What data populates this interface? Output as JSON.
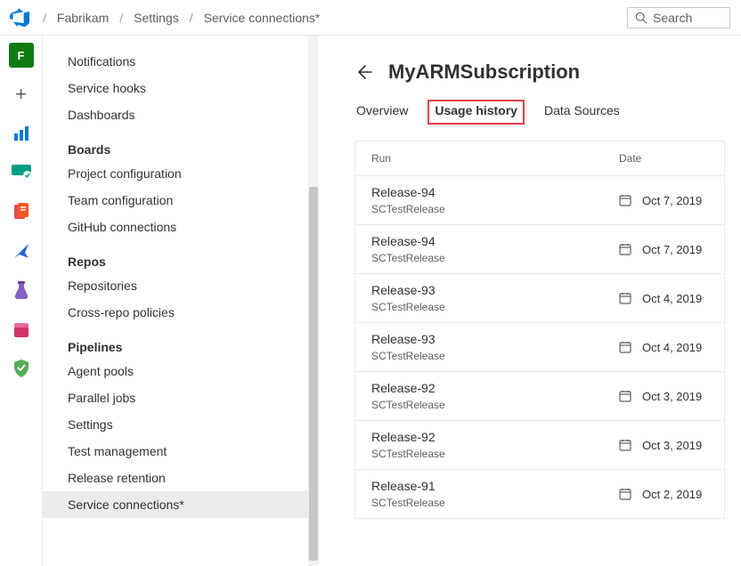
{
  "breadcrumb": [
    "Fabrikam",
    "Settings",
    "Service connections*"
  ],
  "search_placeholder": "Search",
  "iconrail_letter": "F",
  "settings_menu": [
    {
      "label": "Notifications",
      "type": "item"
    },
    {
      "label": "Service hooks",
      "type": "item"
    },
    {
      "label": "Dashboards",
      "type": "item"
    },
    {
      "label": "Boards",
      "type": "hdr"
    },
    {
      "label": "Project configuration",
      "type": "item"
    },
    {
      "label": "Team configuration",
      "type": "item"
    },
    {
      "label": "GitHub connections",
      "type": "item"
    },
    {
      "label": "Repos",
      "type": "hdr"
    },
    {
      "label": "Repositories",
      "type": "item"
    },
    {
      "label": "Cross-repo policies",
      "type": "item"
    },
    {
      "label": "Pipelines",
      "type": "hdr"
    },
    {
      "label": "Agent pools",
      "type": "item"
    },
    {
      "label": "Parallel jobs",
      "type": "item"
    },
    {
      "label": "Settings",
      "type": "item"
    },
    {
      "label": "Test management",
      "type": "item"
    },
    {
      "label": "Release retention",
      "type": "item"
    },
    {
      "label": "Service connections*",
      "type": "item",
      "selected": true
    }
  ],
  "page_title": "MyARMSubscription",
  "tabs": [
    {
      "label": "Overview",
      "active": false
    },
    {
      "label": "Usage history",
      "active": true,
      "highlight": true
    },
    {
      "label": "Data Sources",
      "active": false
    }
  ],
  "table": {
    "run_header": "Run",
    "date_header": "Date",
    "rows": [
      {
        "name": "Release-94",
        "sub": "SCTestRelease",
        "date": "Oct 7, 2019"
      },
      {
        "name": "Release-94",
        "sub": "SCTestRelease",
        "date": "Oct 7, 2019"
      },
      {
        "name": "Release-93",
        "sub": "SCTestRelease",
        "date": "Oct 4, 2019"
      },
      {
        "name": "Release-93",
        "sub": "SCTestRelease",
        "date": "Oct 4, 2019"
      },
      {
        "name": "Release-92",
        "sub": "SCTestRelease",
        "date": "Oct 3, 2019"
      },
      {
        "name": "Release-92",
        "sub": "SCTestRelease",
        "date": "Oct 3, 2019"
      },
      {
        "name": "Release-91",
        "sub": "SCTestRelease",
        "date": "Oct 2, 2019"
      }
    ]
  }
}
